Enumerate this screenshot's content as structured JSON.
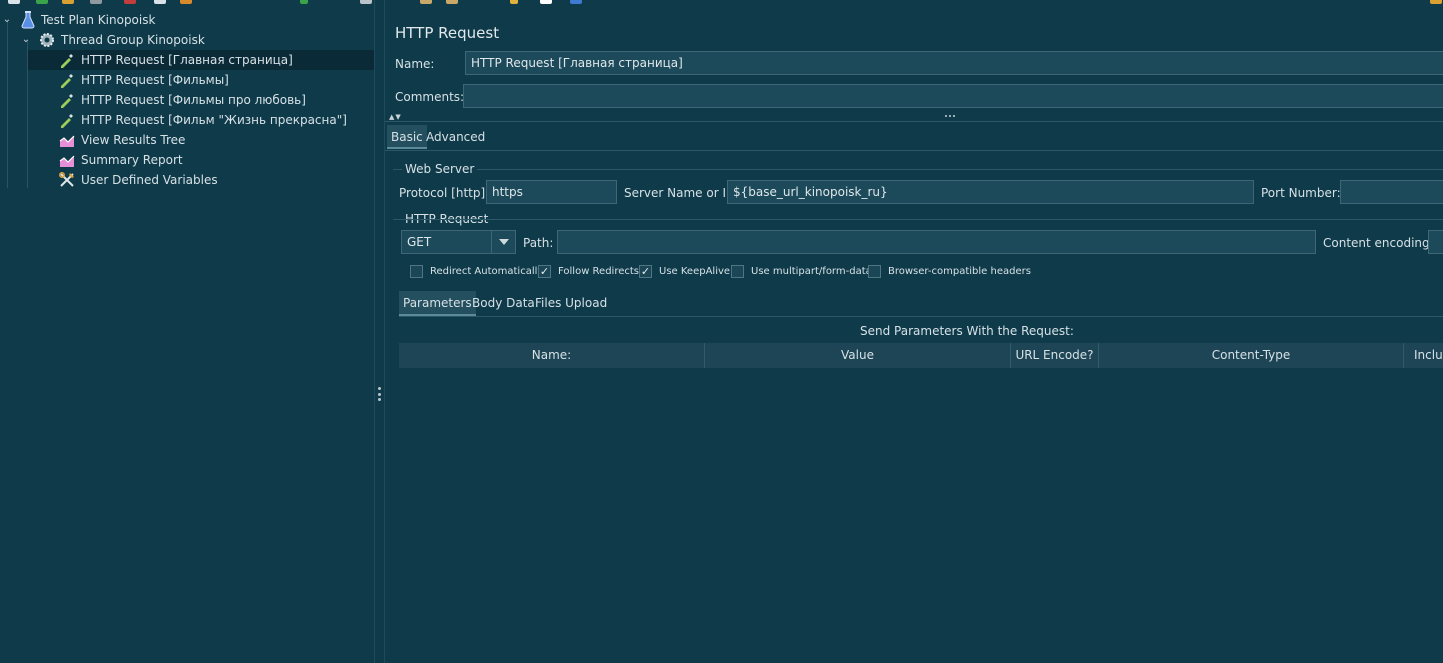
{
  "tree": {
    "items": [
      {
        "label": "Test Plan Kinopoisk",
        "icon": "flask-icon"
      },
      {
        "label": "Thread Group Kinopoisk",
        "icon": "gear-icon"
      },
      {
        "label": "HTTP Request [Главная страница]",
        "icon": "pipette-icon",
        "selected": true
      },
      {
        "label": "HTTP Request [Фильмы]",
        "icon": "pipette-icon"
      },
      {
        "label": "HTTP Request [Фильмы про любовь]",
        "icon": "pipette-icon"
      },
      {
        "label": "HTTP Request [Фильм \"Жизнь прекрасна\"]",
        "icon": "pipette-icon"
      },
      {
        "label": "View Results Tree",
        "icon": "chart-icon"
      },
      {
        "label": "Summary Report",
        "icon": "chart-icon"
      },
      {
        "label": "User Defined Variables",
        "icon": "tools-icon"
      }
    ]
  },
  "panel": {
    "title": "HTTP Request",
    "name_label": "Name:",
    "name_value": "HTTP Request [Главная страница]",
    "comments_label": "Comments:",
    "comments_value": "",
    "tabs": [
      "Basic",
      "Advanced"
    ],
    "web_server": {
      "section_label": "Web Server",
      "protocol_label": "Protocol [http]:",
      "protocol_value": "https",
      "server_label": "Server Name or IP:",
      "server_value": "${base_url_kinopoisk_ru}",
      "port_label": "Port Number:",
      "port_value": ""
    },
    "http_request": {
      "section_label": "HTTP Request",
      "method": "GET",
      "path_label": "Path:",
      "path_value": "",
      "encoding_label": "Content encoding:",
      "encoding_value": ""
    },
    "checkboxes": [
      {
        "label": "Redirect Automatically",
        "checked": false
      },
      {
        "label": "Follow Redirects",
        "checked": true
      },
      {
        "label": "Use KeepAlive",
        "checked": true
      },
      {
        "label": "Use multipart/form-data",
        "checked": false
      },
      {
        "label": "Browser-compatible headers",
        "checked": false
      }
    ],
    "param_tabs": [
      "Parameters",
      "Body Data",
      "Files Upload"
    ],
    "params_caption": "Send Parameters With the Request:",
    "columns": [
      "Name:",
      "Value",
      "URL Encode?",
      "Content-Type",
      "Includ"
    ]
  },
  "check_mark": "✓",
  "colors": {
    "background": "#0f3a4a",
    "selected_row": "#0b2a38",
    "field_bg": "#1c4a5a",
    "active_tab": "#244f5f"
  }
}
